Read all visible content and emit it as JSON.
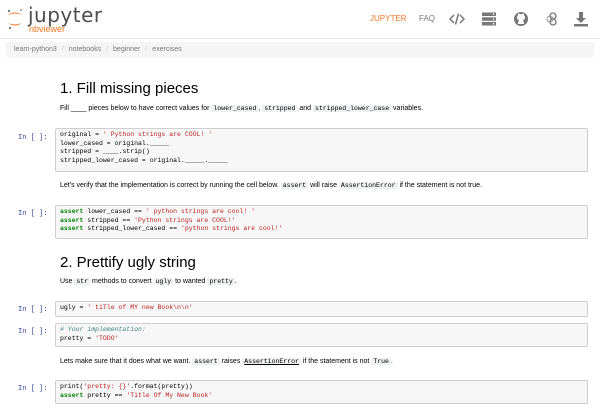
{
  "header": {
    "logo_name": "jupyter",
    "logo_sub": "nbviewer",
    "nav_jupyter": "JUPYTER",
    "nav_faq": "FAQ",
    "icons": [
      "code-icon",
      "server-icon",
      "github-icon",
      "binder-icon",
      "download-icon"
    ],
    "accent_color": "#f37726"
  },
  "breadcrumb": [
    "learn-python3",
    "notebooks",
    "beginner",
    "exercises"
  ],
  "sections": {
    "s1_title": "1. Fill missing pieces",
    "s1_p1_a": "Fill ",
    "s1_p1_blank": "____",
    "s1_p1_b": " pieces below to have correct values for ",
    "s1_p1_c1": "lower_cased",
    "s1_p1_comma": ", ",
    "s1_p1_c2": "stripped",
    "s1_p1_and": " and ",
    "s1_p1_c3": "stripped_lower_case",
    "s1_p1_end": " variables.",
    "s1_p2_a": "Let's verify that the implementation is correct by running the cell below. ",
    "s1_p2_c1": "assert",
    "s1_p2_b": " will raise ",
    "s1_p2_c2": "AssertionError",
    "s1_p2_end": " if the statement is not true.",
    "s2_title": "2. Prettify ugly string",
    "s2_p1_a": "Use ",
    "s2_p1_c1": "str",
    "s2_p1_b": " methods to convert ",
    "s2_p1_c2": "ugly",
    "s2_p1_c": " to wanted ",
    "s2_p1_c3": "pretty",
    "s2_p1_end": ".",
    "s2_p2_a": "Lets make sure that it does what we want. ",
    "s2_p2_c1": "assert",
    "s2_p2_b": " raises ",
    "s2_p2_c2": "AssertionError",
    "s2_p2_c": " if the statement is not ",
    "s2_p2_c3": "True",
    "s2_p2_end": "."
  },
  "cells": {
    "prompt": "In [ ]:",
    "c1_l1a": "original = ",
    "c1_l1b": "' Python strings are COOL! '",
    "c1_l2": "lower_cased = original._____",
    "c1_l3": "stripped = ____.strip()",
    "c1_l4": "stripped_lower_cased = original._____._____",
    "c2_l1a": "assert",
    "c2_l1b": " lower_cased == ",
    "c2_l1c": "' python strings are cool! '",
    "c2_l2a": "assert",
    "c2_l2b": " stripped == ",
    "c2_l2c": "'Python strings are COOL!'",
    "c2_l3a": "assert",
    "c2_l3b": " stripped_lower_cased == ",
    "c2_l3c": "'python strings are cool!'",
    "c3_l1a": "ugly = ",
    "c3_l1b": "' tiTle of MY new Book\\n\\n'",
    "c4_l1": "# Your implementation:",
    "c4_l2a": "pretty = ",
    "c4_l2b": "'TODO'",
    "c5_l1a": "print(",
    "c5_l1b": "'pretty: {}'",
    "c5_l1c": ".format(pretty))",
    "c5_l2a": "assert",
    "c5_l2b": " pretty == ",
    "c5_l2c": "'Title Of My New Book'"
  }
}
